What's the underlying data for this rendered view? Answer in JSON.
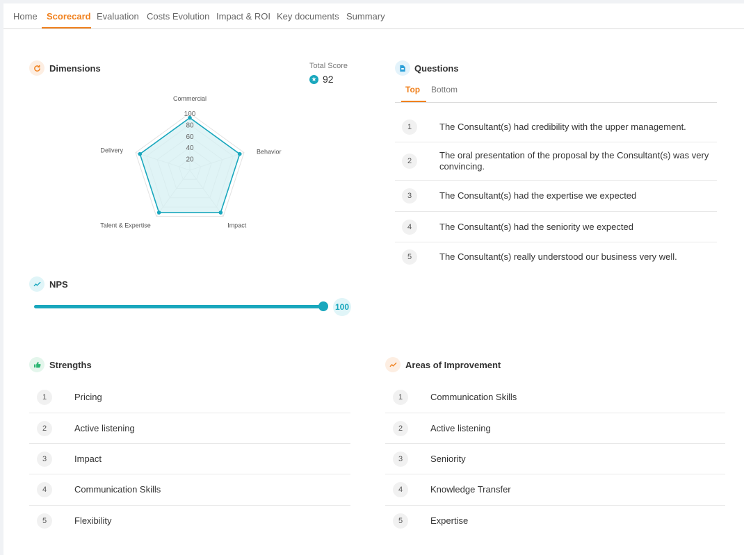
{
  "tabs": [
    "Home",
    "Scorecard",
    "Evaluation",
    "Costs Evolution",
    "Impact & ROI",
    "Key documents",
    "Summary"
  ],
  "active_tab": "Scorecard",
  "dimensions": {
    "title": "Dimensions",
    "icon": "refresh-icon",
    "total_score_label": "Total Score",
    "total_score_value": "92"
  },
  "chart_data": {
    "type": "radar",
    "axes": [
      "Commercial",
      "Behavior",
      "Impact",
      "Talent & Expertise",
      "Delivery"
    ],
    "values": [
      92,
      92,
      92,
      92,
      92
    ],
    "ticks": [
      "20",
      "40",
      "60",
      "80",
      "100"
    ],
    "range": [
      0,
      100
    ],
    "colors": {
      "line": "#19a7bd",
      "fill": "#d6f0f3"
    }
  },
  "questions": {
    "title": "Questions",
    "icon": "document-icon",
    "tabs": [
      "Top",
      "Bottom"
    ],
    "active_tab": "Top",
    "items": [
      {
        "num": "1",
        "text": "The Consultant(s) had credibility with the upper management."
      },
      {
        "num": "2",
        "text": "The oral presentation of the proposal by the Consultant(s) was very convincing."
      },
      {
        "num": "3",
        "text": "The Consultant(s) had the expertise we expected"
      },
      {
        "num": "4",
        "text": "The Consultant(s) had the seniority we expected"
      },
      {
        "num": "5",
        "text": "The Consultant(s) really understood our business very well."
      }
    ]
  },
  "nps": {
    "title": "NPS",
    "icon": "trend-icon",
    "value": "100",
    "fraction": 1.0
  },
  "strengths": {
    "title": "Strengths",
    "icon": "thumbs-up-icon",
    "items": [
      {
        "num": "1",
        "text": "Pricing"
      },
      {
        "num": "2",
        "text": "Active listening"
      },
      {
        "num": "3",
        "text": "Impact"
      },
      {
        "num": "4",
        "text": "Communication Skills"
      },
      {
        "num": "5",
        "text": "Flexibility"
      }
    ]
  },
  "improvements": {
    "title": "Areas of Improvement",
    "icon": "trend-icon",
    "items": [
      {
        "num": "1",
        "text": "Communication Skills"
      },
      {
        "num": "2",
        "text": "Active listening"
      },
      {
        "num": "3",
        "text": "Seniority"
      },
      {
        "num": "4",
        "text": "Knowledge Transfer"
      },
      {
        "num": "5",
        "text": "Expertise"
      }
    ]
  },
  "colors": {
    "accent": "#f0811e",
    "teal": "#19a7bd",
    "green": "#2bb673"
  }
}
